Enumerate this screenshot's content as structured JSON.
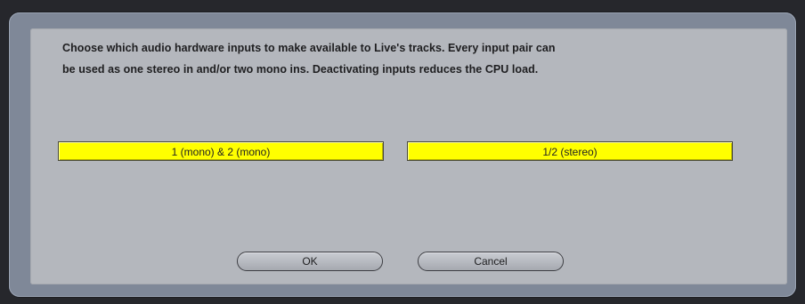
{
  "dialog": {
    "description_lines": [
      "Choose which audio hardware inputs to make available to Live's tracks. Every input pair can",
      "be used as one stereo in and/or two mono ins.  Deactivating inputs reduces the CPU load."
    ],
    "inputs": [
      {
        "label": "1 (mono) & 2 (mono)",
        "active": true
      },
      {
        "label": "1/2 (stereo)",
        "active": true
      }
    ],
    "buttons": {
      "ok_label": "OK",
      "cancel_label": "Cancel"
    }
  },
  "colors": {
    "active_toggle": "#ffff00",
    "panel": "#b4b7bd",
    "bezel": "#7f8898",
    "backdrop": "#26272c"
  }
}
